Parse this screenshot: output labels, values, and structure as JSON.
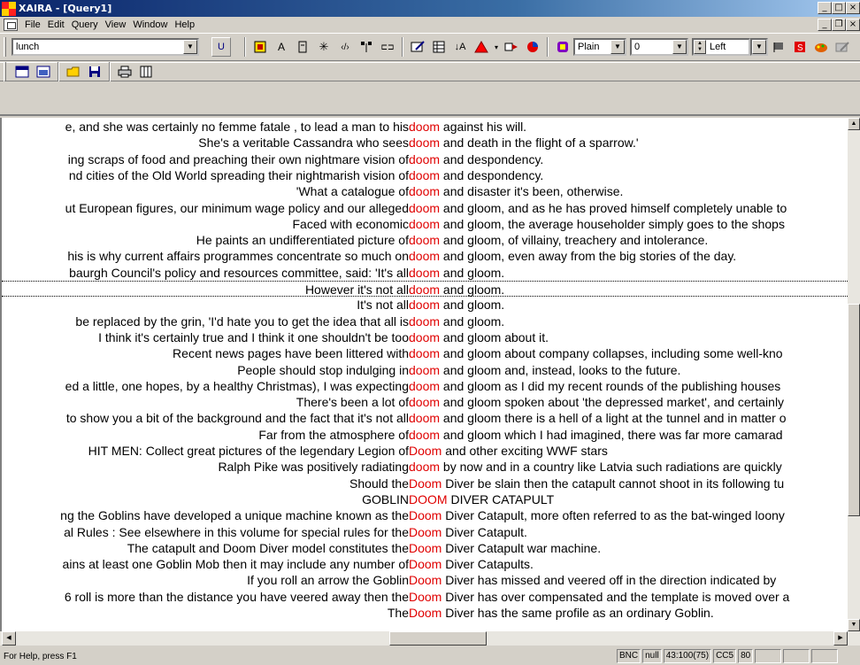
{
  "window": {
    "title": "XAIRA - [Query1]"
  },
  "menu": [
    "File",
    "Edit",
    "Query",
    "View",
    "Window",
    "Help"
  ],
  "toolbar": {
    "search_value": "lunch",
    "u_button": "U",
    "a_button": "A",
    "style_value": "Plain",
    "number_value": "0",
    "align_value": "Left"
  },
  "concordance": [
    {
      "left": "e, and she was certainly no femme fatale , to lead a man to his ",
      "kw": "doom",
      "right": " against his will."
    },
    {
      "left": "She's a veritable Cassandra who sees ",
      "kw": "doom",
      "right": " and death in the flight of a sparrow.'"
    },
    {
      "left": "ing scraps of food and preaching their own nightmare vision of ",
      "kw": "doom",
      "right": " and despondency."
    },
    {
      "left": "nd cities of the Old World spreading their nightmarish vision of ",
      "kw": "doom",
      "right": " and despondency."
    },
    {
      "left": "'What a catalogue of ",
      "kw": "doom",
      "right": " and disaster it's been, otherwise."
    },
    {
      "left": "ut European figures, our minimum wage policy and our alleged ",
      "kw": "doom",
      "right": " and gloom, and as he has proved himself completely unable to"
    },
    {
      "left": "Faced with economic ",
      "kw": "doom",
      "right": " and gloom, the average householder simply goes to the shops"
    },
    {
      "left": "He paints an undifferentiated picture of ",
      "kw": "doom",
      "right": " and gloom, of villainy, treachery and intolerance."
    },
    {
      "left": "his is why current affairs programmes concentrate so much on ",
      "kw": "doom",
      "right": " and gloom, even away from the big stories of the day."
    },
    {
      "left": "baurgh Council's policy and resources committee, said: 'It's all ",
      "kw": "doom",
      "right": " and gloom."
    },
    {
      "left": "However it's not all ",
      "kw": "doom",
      "right": " and gloom."
    },
    {
      "left": "It's not all ",
      "kw": "doom",
      "right": " and gloom."
    },
    {
      "left": "be replaced by the grin, 'I'd hate you to get the idea that all is ",
      "kw": "doom",
      "right": " and gloom."
    },
    {
      "left": "I think it's certainly true and I think it one shouldn't be too ",
      "kw": "doom",
      "right": " and gloom about it."
    },
    {
      "left": "Recent news pages have been littered with ",
      "kw": "doom",
      "right": " and gloom about company collapses, including some well-kno"
    },
    {
      "left": "People should stop indulging in ",
      "kw": "doom",
      "right": " and gloom and, instead, looks to the future."
    },
    {
      "left": "ed a little, one hopes, by a healthy Christmas), I was expecting ",
      "kw": "doom",
      "right": " and gloom as I did my recent rounds of the publishing houses"
    },
    {
      "left": "There's been a lot of ",
      "kw": "doom",
      "right": " and gloom spoken about 'the depressed market', and certainly"
    },
    {
      "left": "to show you a bit of the background and the fact that it's not all ",
      "kw": "doom",
      "right": " and gloom there is a hell of a light at the tunnel and in matter o"
    },
    {
      "left": "Far from the atmosphere of ",
      "kw": "doom",
      "right": " and gloom which I had imagined, there was far more camarad"
    },
    {
      "left": "HIT MEN: Collect great pictures of the legendary Legion of ",
      "kw": "Doom",
      "right": " and other exciting WWF stars"
    },
    {
      "left": "Ralph Pike was positively radiating ",
      "kw": "doom",
      "right": " by now and in a country like Latvia such radiations are quickly"
    },
    {
      "left": "Should the ",
      "kw": "Doom",
      "right": " Diver be slain then the catapult cannot shoot in its following tu"
    },
    {
      "left": "GOBLIN ",
      "kw": "DOOM",
      "right": " DIVER CATAPULT"
    },
    {
      "left": "ng the Goblins have developed a unique machine known as the ",
      "kw": "Doom",
      "right": " Diver Catapult, more often referred to as the bat-winged loony"
    },
    {
      "left": "al Rules : See elsewhere in this volume for special rules for the ",
      "kw": "Doom",
      "right": " Diver Catapult."
    },
    {
      "left": "The catapult and Doom Diver model constitutes the ",
      "kw": "Doom",
      "right": " Diver Catapult war machine."
    },
    {
      "left": "ains at least one Goblin Mob then it may include any number of ",
      "kw": "Doom",
      "right": " Diver Catapults."
    },
    {
      "left": "If you roll an arrow the Goblin ",
      "kw": "Doom",
      "right": " Diver has missed and veered off in the direction indicated by"
    },
    {
      "left": "6 roll is more than the distance you have veered away then the ",
      "kw": "Doom",
      "right": " Diver has over compensated and the template is moved over a"
    },
    {
      "left": "The ",
      "kw": "Doom",
      "right": " Diver has the same profile as an ordinary Goblin."
    }
  ],
  "status": {
    "help": "For Help, press F1",
    "panels": [
      "BNC",
      "null",
      "43:100(75)",
      "CC5",
      "80"
    ]
  }
}
